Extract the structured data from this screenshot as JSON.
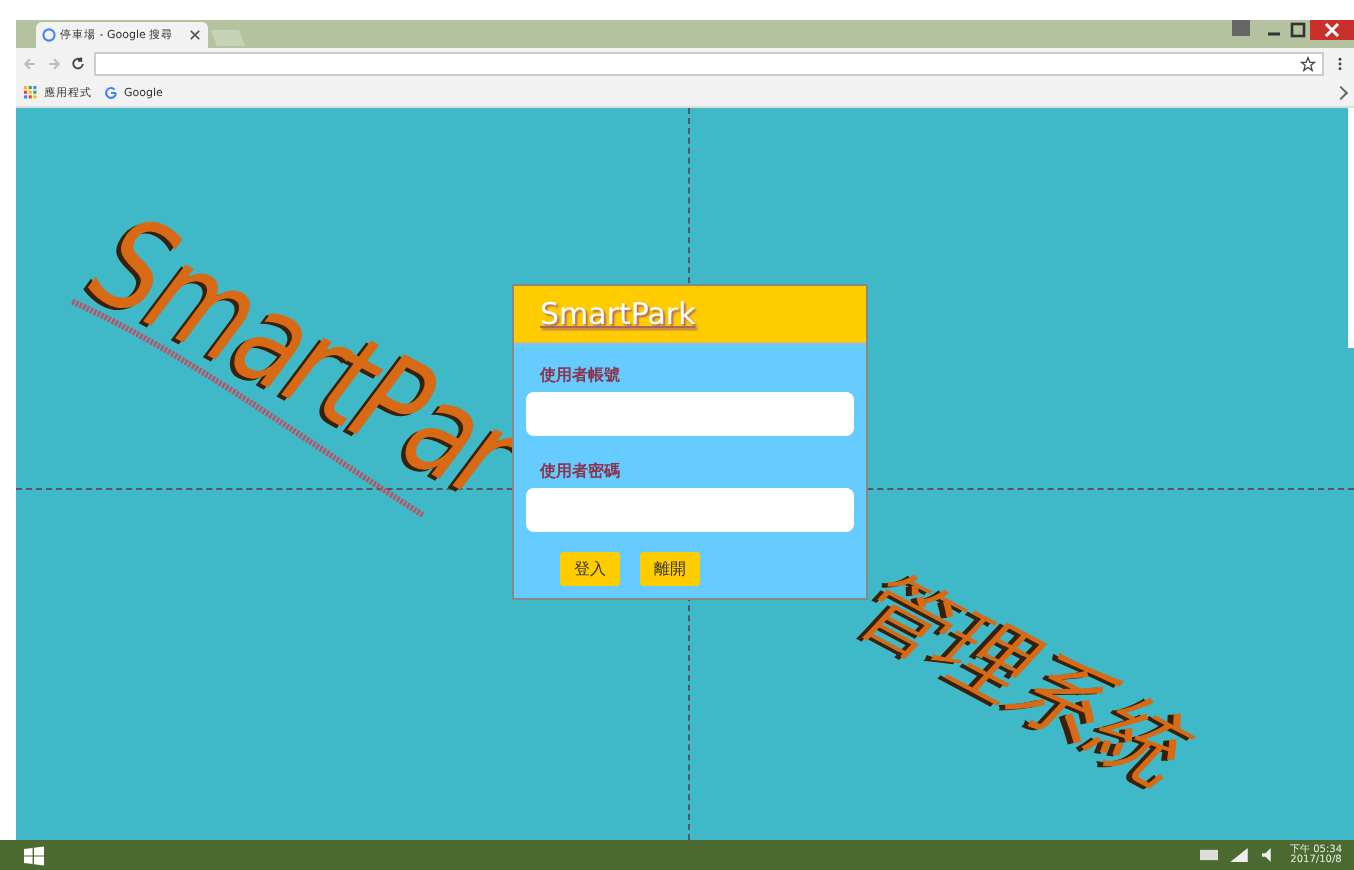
{
  "browser": {
    "tab_title": "停車場 - Google 搜尋",
    "bookmarks": [
      {
        "label": "應用程式",
        "kind": "apps"
      },
      {
        "label": "Google",
        "kind": "google"
      }
    ]
  },
  "banner": {
    "title": "SmartPar",
    "subtitle": "管理系統"
  },
  "login": {
    "title": "SmartPark",
    "fields": [
      {
        "label": "使用者帳號"
      },
      {
        "label": "使用者密碼"
      }
    ],
    "buttons": [
      "登入",
      "離開"
    ]
  },
  "taskbar": {
    "time": "下午 05:34",
    "date": "2017/10/8"
  }
}
